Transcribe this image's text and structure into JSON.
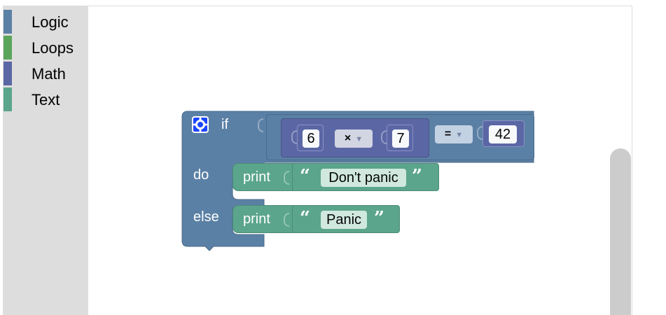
{
  "toolbox": {
    "categories": [
      {
        "label": "Logic",
        "color": "#5b80a5"
      },
      {
        "label": "Loops",
        "color": "#5ba55b"
      },
      {
        "label": "Math",
        "color": "#5b67a5"
      },
      {
        "label": "Text",
        "color": "#5ba58c"
      }
    ]
  },
  "blocks": {
    "if_block": {
      "color": "#5b80a5",
      "if_label": "if",
      "do_label": "do",
      "else_label": "else",
      "gear_icon": "gear-icon",
      "condition": {
        "left": {
          "a": "6",
          "op": "×",
          "b": "7"
        },
        "op": "=",
        "right": "42"
      },
      "do_stmt": {
        "keyword": "print",
        "text": "Don't panic"
      },
      "else_stmt": {
        "keyword": "print",
        "text": "Panic"
      }
    }
  },
  "quotes": {
    "open": "“",
    "close": "”"
  }
}
